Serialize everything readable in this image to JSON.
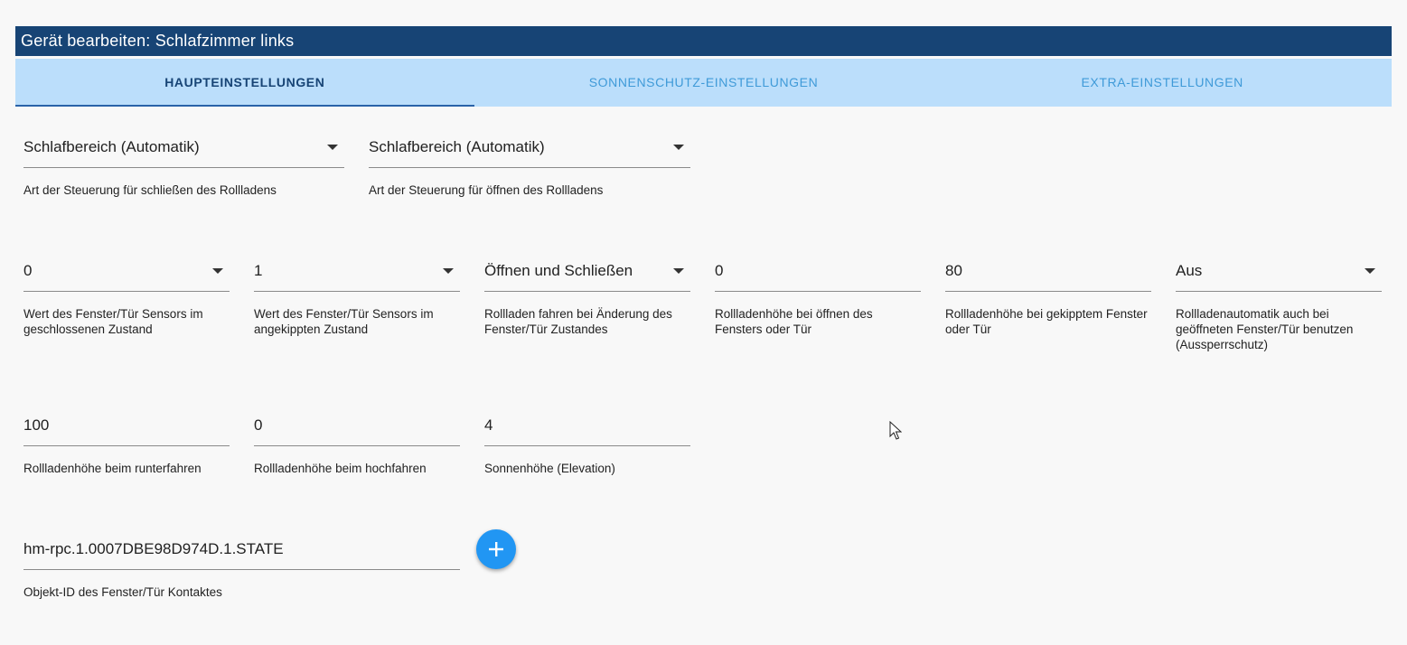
{
  "dialog": {
    "title": "Gerät bearbeiten: Schlafzimmer links"
  },
  "tabs": [
    {
      "label": "HAUPTEINSTELLUNGEN",
      "active": true
    },
    {
      "label": "SONNENSCHUTZ-EINSTELLUNGEN",
      "active": false
    },
    {
      "label": "EXTRA-EINSTELLUNGEN",
      "active": false
    }
  ],
  "fields": {
    "close_type": {
      "value": "Schlafbereich (Automatik)",
      "help": "Art der Steuerung für schließen des Rollladens"
    },
    "open_type": {
      "value": "Schlafbereich (Automatik)",
      "help": "Art der Steuerung für öffnen des Rollladens"
    },
    "sensor_closed": {
      "value": "0",
      "help": "Wert des Fenster/Tür Sensors im geschlossenen Zustand"
    },
    "sensor_tilted": {
      "value": "1",
      "help": "Wert des Fenster/Tür Sensors im angekippten Zustand"
    },
    "drive_on_change": {
      "value": "Öffnen und Schließen",
      "help": "Rollladen fahren bei Änderung des Fenster/Tür Zustandes"
    },
    "height_open": {
      "value": "0",
      "help": "Rollladenhöhe bei öffnen des Fensters oder Tür"
    },
    "height_tilted": {
      "value": "80",
      "help": "Rollladenhöhe bei gekipptem Fenster oder Tür"
    },
    "lockout": {
      "value": "Aus",
      "help": "Rollladenautomatik auch bei geöffneten Fenster/Tür benutzen (Aussperrschutz)"
    },
    "height_down": {
      "value": "100",
      "help": "Rollladenhöhe beim runterfahren"
    },
    "height_up": {
      "value": "0",
      "help": "Rollladenhöhe beim hochfahren"
    },
    "elevation": {
      "value": "4",
      "help": "Sonnenhöhe (Elevation)"
    },
    "object_id": {
      "value": "hm-rpc.1.0007DBE98D974D.1.STATE",
      "help": "Objekt-ID des Fenster/Tür Kontaktes"
    }
  },
  "icons": {
    "add": "plus-icon",
    "dropdown": "chevron-down-icon",
    "cursor": "mouse-pointer-icon"
  },
  "colors": {
    "header": "#174475",
    "tabs_bg": "#bbdefb",
    "fab": "#2196f3"
  }
}
